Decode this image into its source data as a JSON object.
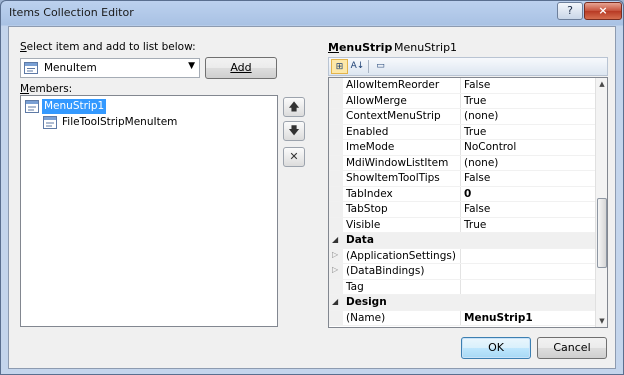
{
  "window": {
    "title": "Items Collection Editor",
    "help_glyph": "?",
    "close_glyph": "×"
  },
  "select_label": "Select item and add to list below:",
  "combo": {
    "value": "MenuItem",
    "arrow": "▼"
  },
  "add_button": "Add",
  "members_label": "Members:",
  "members": [
    {
      "label": "MenuStrip1",
      "selected": true
    },
    {
      "label": "FileToolStripMenuItem",
      "selected": false
    }
  ],
  "side_buttons": {
    "up": "🡅",
    "down": "🡇",
    "remove": "✕"
  },
  "pg_header": {
    "type": "MenuStrip",
    "name": "MenuStrip1"
  },
  "pg_toolbar": {
    "categorized": "⊞",
    "alphabetical": "A↓",
    "pages": "▭"
  },
  "properties": [
    {
      "name": "AllowItemReorder",
      "value": "False"
    },
    {
      "name": "AllowMerge",
      "value": "True"
    },
    {
      "name": "ContextMenuStrip",
      "value": "(none)"
    },
    {
      "name": "Enabled",
      "value": "True"
    },
    {
      "name": "ImeMode",
      "value": "NoControl"
    },
    {
      "name": "MdiWindowListItem",
      "value": "(none)"
    },
    {
      "name": "ShowItemToolTips",
      "value": "False"
    },
    {
      "name": "TabIndex",
      "value": "0",
      "bold": true
    },
    {
      "name": "TabStop",
      "value": "False"
    },
    {
      "name": "Visible",
      "value": "True"
    },
    {
      "category": "Data"
    },
    {
      "name": "(ApplicationSettings)",
      "value": "",
      "expandable": true
    },
    {
      "name": "(DataBindings)",
      "value": "",
      "expandable": true
    },
    {
      "name": "Tag",
      "value": ""
    },
    {
      "category": "Design"
    },
    {
      "name": "(Name)",
      "value": "MenuStrip1",
      "bold": true
    }
  ],
  "ok_button": "OK",
  "cancel_button": "Cancel"
}
